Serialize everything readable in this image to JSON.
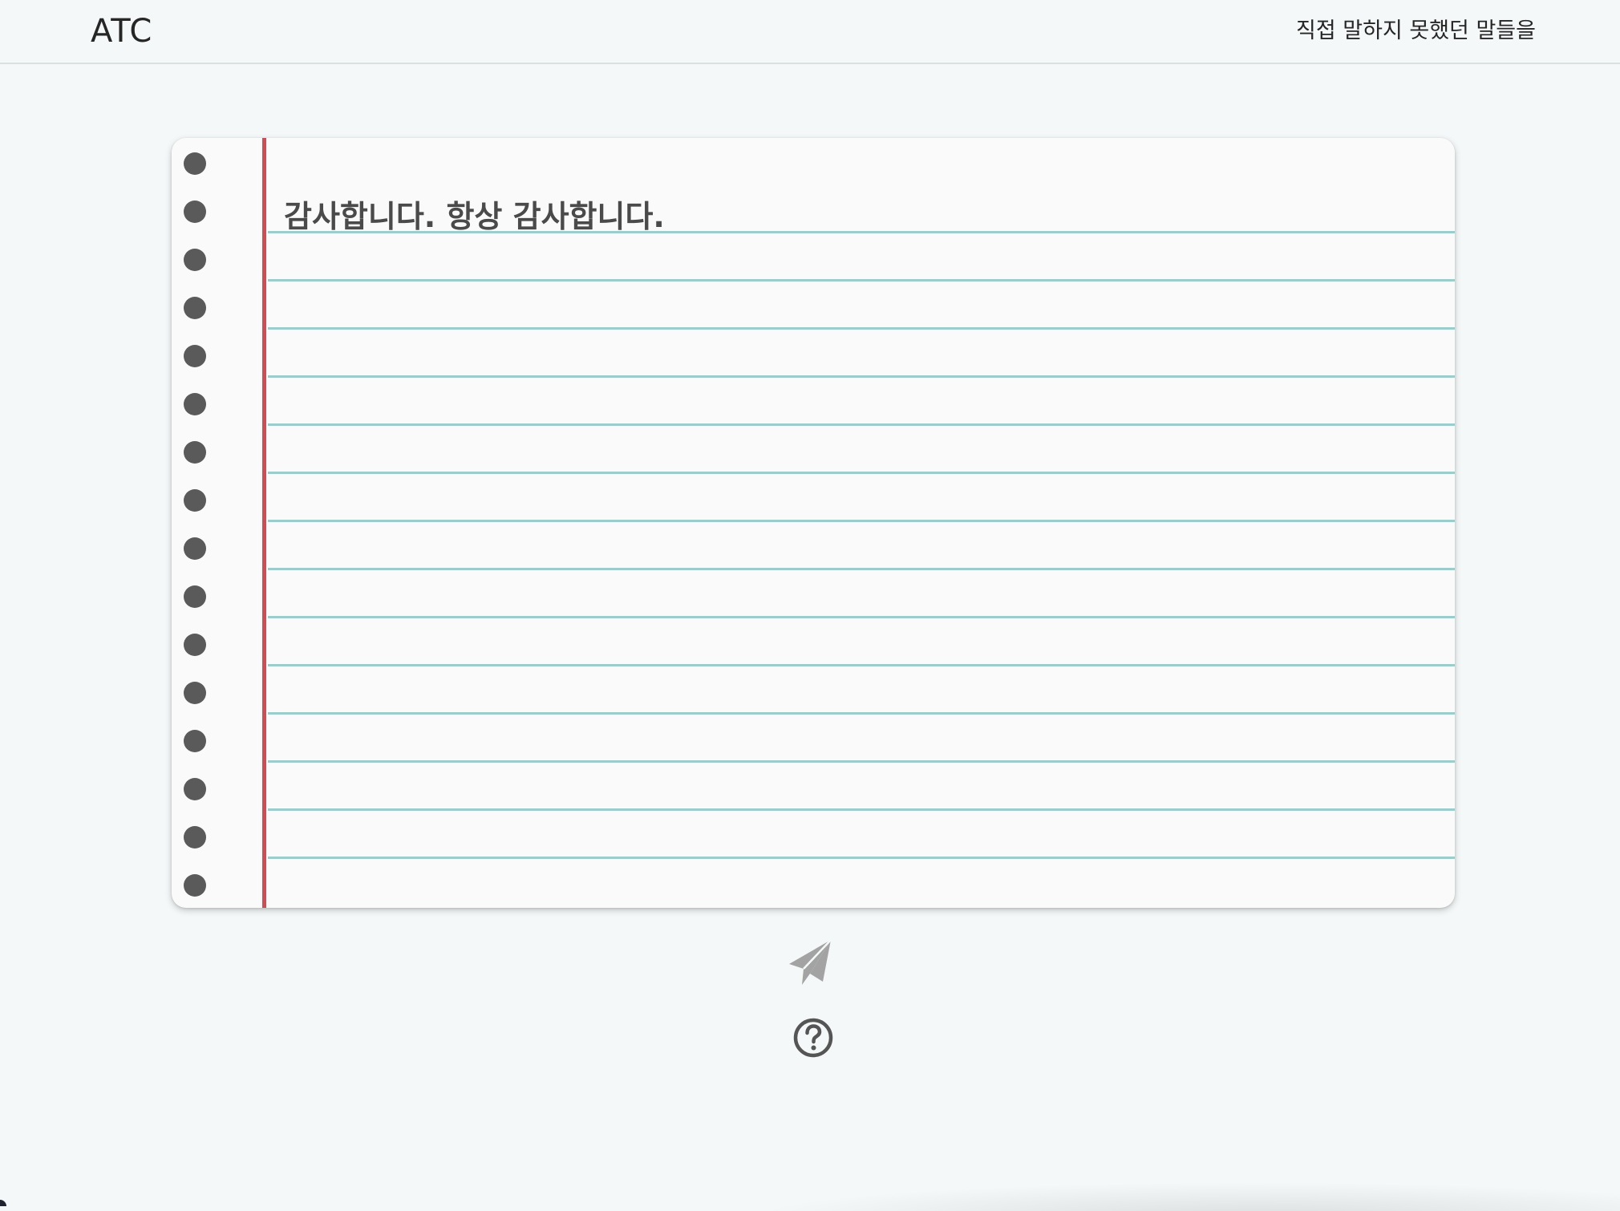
{
  "header": {
    "brand": "ATC",
    "tagline": "직접 말하지 못했던 말들을"
  },
  "notebook": {
    "text": "감사합니다. 항상 감사합니다.",
    "hole_count": 16,
    "line_count": 14,
    "colors": {
      "paper": "#fafafa",
      "margin_line": "#c94f55",
      "rule_line": "#9ccccc",
      "hole": "#5a5a5a"
    }
  },
  "actions": {
    "send_icon": "paper-plane-icon",
    "help_icon": "question-circle-icon"
  }
}
